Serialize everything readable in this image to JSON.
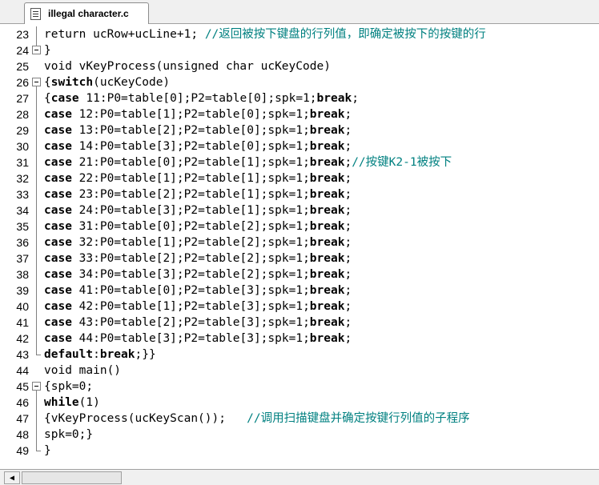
{
  "tab": {
    "label": "illegal character.c",
    "icon": "document-icon"
  },
  "editor": {
    "lines": [
      {
        "n": "23",
        "fold": "line",
        "segs": [
          [
            "t",
            "return ucRow+ucLine+"
          ],
          [
            "n",
            "1"
          ],
          [
            "t",
            "; "
          ],
          [
            "c",
            "//返回被按下键盘的行列值，即确定被按下的按键的行"
          ]
        ]
      },
      {
        "n": "24",
        "fold": "box",
        "segs": [
          [
            "t",
            "}"
          ]
        ]
      },
      {
        "n": "25",
        "fold": "none",
        "segs": [
          [
            "t",
            "void vKeyProcess(unsigned char ucKeyCode)"
          ]
        ]
      },
      {
        "n": "26",
        "fold": "box",
        "segs": [
          [
            "t",
            "{"
          ],
          [
            "k",
            "switch"
          ],
          [
            "t",
            "(ucKeyCode)"
          ]
        ]
      },
      {
        "n": "27",
        "fold": "line",
        "segs": [
          [
            "t",
            "{"
          ],
          [
            "k",
            "case"
          ],
          [
            "t",
            " "
          ],
          [
            "n",
            "11"
          ],
          [
            "t",
            ":P0=table["
          ],
          [
            "n",
            "0"
          ],
          [
            "t",
            "];P2=table["
          ],
          [
            "n",
            "0"
          ],
          [
            "t",
            "];spk="
          ],
          [
            "n",
            "1"
          ],
          [
            "t",
            ";"
          ],
          [
            "k",
            "break"
          ],
          [
            "t",
            ";"
          ]
        ]
      },
      {
        "n": "28",
        "fold": "line",
        "segs": [
          [
            "k",
            "case"
          ],
          [
            "t",
            " "
          ],
          [
            "n",
            "12"
          ],
          [
            "t",
            ":P0=table["
          ],
          [
            "n",
            "1"
          ],
          [
            "t",
            "];P2=table["
          ],
          [
            "n",
            "0"
          ],
          [
            "t",
            "];spk="
          ],
          [
            "n",
            "1"
          ],
          [
            "t",
            ";"
          ],
          [
            "k",
            "break"
          ],
          [
            "t",
            ";"
          ]
        ]
      },
      {
        "n": "29",
        "fold": "line",
        "segs": [
          [
            "k",
            "case"
          ],
          [
            "t",
            " "
          ],
          [
            "n",
            "13"
          ],
          [
            "t",
            ":P0=table["
          ],
          [
            "n",
            "2"
          ],
          [
            "t",
            "];P2=table["
          ],
          [
            "n",
            "0"
          ],
          [
            "t",
            "];spk="
          ],
          [
            "n",
            "1"
          ],
          [
            "t",
            ";"
          ],
          [
            "k",
            "break"
          ],
          [
            "t",
            ";"
          ]
        ]
      },
      {
        "n": "30",
        "fold": "line",
        "segs": [
          [
            "k",
            "case"
          ],
          [
            "t",
            " "
          ],
          [
            "n",
            "14"
          ],
          [
            "t",
            ":P0=table["
          ],
          [
            "n",
            "3"
          ],
          [
            "t",
            "];P2=table["
          ],
          [
            "n",
            "0"
          ],
          [
            "t",
            "];spk="
          ],
          [
            "n",
            "1"
          ],
          [
            "t",
            ";"
          ],
          [
            "k",
            "break"
          ],
          [
            "t",
            ";"
          ]
        ]
      },
      {
        "n": "31",
        "fold": "line",
        "segs": [
          [
            "k",
            "case"
          ],
          [
            "t",
            " "
          ],
          [
            "n",
            "21"
          ],
          [
            "t",
            ":P0=table["
          ],
          [
            "n",
            "0"
          ],
          [
            "t",
            "];P2=table["
          ],
          [
            "n",
            "1"
          ],
          [
            "t",
            "];spk="
          ],
          [
            "n",
            "1"
          ],
          [
            "t",
            ";"
          ],
          [
            "k",
            "break"
          ],
          [
            "t",
            ";"
          ],
          [
            "c",
            "//按键K2-1被按下"
          ]
        ]
      },
      {
        "n": "32",
        "fold": "line",
        "segs": [
          [
            "k",
            "case"
          ],
          [
            "t",
            " "
          ],
          [
            "n",
            "22"
          ],
          [
            "t",
            ":P0=table["
          ],
          [
            "n",
            "1"
          ],
          [
            "t",
            "];P2=table["
          ],
          [
            "n",
            "1"
          ],
          [
            "t",
            "];spk="
          ],
          [
            "n",
            "1"
          ],
          [
            "t",
            ";"
          ],
          [
            "k",
            "break"
          ],
          [
            "t",
            ";"
          ]
        ]
      },
      {
        "n": "33",
        "fold": "line",
        "segs": [
          [
            "k",
            "case"
          ],
          [
            "t",
            " "
          ],
          [
            "n",
            "23"
          ],
          [
            "t",
            ":P0=table["
          ],
          [
            "n",
            "2"
          ],
          [
            "t",
            "];P2=table["
          ],
          [
            "n",
            "1"
          ],
          [
            "t",
            "];spk="
          ],
          [
            "n",
            "1"
          ],
          [
            "t",
            ";"
          ],
          [
            "k",
            "break"
          ],
          [
            "t",
            ";"
          ]
        ]
      },
      {
        "n": "34",
        "fold": "line",
        "segs": [
          [
            "k",
            "case"
          ],
          [
            "t",
            " "
          ],
          [
            "n",
            "24"
          ],
          [
            "t",
            ":P0=table["
          ],
          [
            "n",
            "3"
          ],
          [
            "t",
            "];P2=table["
          ],
          [
            "n",
            "1"
          ],
          [
            "t",
            "];spk="
          ],
          [
            "n",
            "1"
          ],
          [
            "t",
            ";"
          ],
          [
            "k",
            "break"
          ],
          [
            "t",
            ";"
          ]
        ]
      },
      {
        "n": "35",
        "fold": "line",
        "segs": [
          [
            "k",
            "case"
          ],
          [
            "t",
            " "
          ],
          [
            "n",
            "31"
          ],
          [
            "t",
            ":P0=table["
          ],
          [
            "n",
            "0"
          ],
          [
            "t",
            "];P2=table["
          ],
          [
            "n",
            "2"
          ],
          [
            "t",
            "];spk="
          ],
          [
            "n",
            "1"
          ],
          [
            "t",
            ";"
          ],
          [
            "k",
            "break"
          ],
          [
            "t",
            ";"
          ]
        ]
      },
      {
        "n": "36",
        "fold": "line",
        "segs": [
          [
            "k",
            "case"
          ],
          [
            "t",
            " "
          ],
          [
            "n",
            "32"
          ],
          [
            "t",
            ":P0=table["
          ],
          [
            "n",
            "1"
          ],
          [
            "t",
            "];P2=table["
          ],
          [
            "n",
            "2"
          ],
          [
            "t",
            "];spk="
          ],
          [
            "n",
            "1"
          ],
          [
            "t",
            ";"
          ],
          [
            "k",
            "break"
          ],
          [
            "t",
            ";"
          ]
        ]
      },
      {
        "n": "37",
        "fold": "line",
        "segs": [
          [
            "k",
            "case"
          ],
          [
            "t",
            " "
          ],
          [
            "n",
            "33"
          ],
          [
            "t",
            ":P0=table["
          ],
          [
            "n",
            "2"
          ],
          [
            "t",
            "];P2=table["
          ],
          [
            "n",
            "2"
          ],
          [
            "t",
            "];spk="
          ],
          [
            "n",
            "1"
          ],
          [
            "t",
            ";"
          ],
          [
            "k",
            "break"
          ],
          [
            "t",
            ";"
          ]
        ]
      },
      {
        "n": "38",
        "fold": "line",
        "segs": [
          [
            "k",
            "case"
          ],
          [
            "t",
            " "
          ],
          [
            "n",
            "34"
          ],
          [
            "t",
            ":P0=table["
          ],
          [
            "n",
            "3"
          ],
          [
            "t",
            "];P2=table["
          ],
          [
            "n",
            "2"
          ],
          [
            "t",
            "];spk="
          ],
          [
            "n",
            "1"
          ],
          [
            "t",
            ";"
          ],
          [
            "k",
            "break"
          ],
          [
            "t",
            ";"
          ]
        ]
      },
      {
        "n": "39",
        "fold": "line",
        "segs": [
          [
            "k",
            "case"
          ],
          [
            "t",
            " "
          ],
          [
            "n",
            "41"
          ],
          [
            "t",
            ":P0=table["
          ],
          [
            "n",
            "0"
          ],
          [
            "t",
            "];P2=table["
          ],
          [
            "n",
            "3"
          ],
          [
            "t",
            "];spk="
          ],
          [
            "n",
            "1"
          ],
          [
            "t",
            ";"
          ],
          [
            "k",
            "break"
          ],
          [
            "t",
            ";"
          ]
        ]
      },
      {
        "n": "40",
        "fold": "line",
        "segs": [
          [
            "k",
            "case"
          ],
          [
            "t",
            " "
          ],
          [
            "n",
            "42"
          ],
          [
            "t",
            ":P0=table["
          ],
          [
            "n",
            "1"
          ],
          [
            "t",
            "];P2=table["
          ],
          [
            "n",
            "3"
          ],
          [
            "t",
            "];spk="
          ],
          [
            "n",
            "1"
          ],
          [
            "t",
            ";"
          ],
          [
            "k",
            "break"
          ],
          [
            "t",
            ";"
          ]
        ]
      },
      {
        "n": "41",
        "fold": "line",
        "segs": [
          [
            "k",
            "case"
          ],
          [
            "t",
            " "
          ],
          [
            "n",
            "43"
          ],
          [
            "t",
            ":P0=table["
          ],
          [
            "n",
            "2"
          ],
          [
            "t",
            "];P2=table["
          ],
          [
            "n",
            "3"
          ],
          [
            "t",
            "];spk="
          ],
          [
            "n",
            "1"
          ],
          [
            "t",
            ";"
          ],
          [
            "k",
            "break"
          ],
          [
            "t",
            ";"
          ]
        ]
      },
      {
        "n": "42",
        "fold": "line",
        "segs": [
          [
            "k",
            "case"
          ],
          [
            "t",
            " "
          ],
          [
            "n",
            "44"
          ],
          [
            "t",
            ":P0=table["
          ],
          [
            "n",
            "3"
          ],
          [
            "t",
            "];P2=table["
          ],
          [
            "n",
            "3"
          ],
          [
            "t",
            "];spk="
          ],
          [
            "n",
            "1"
          ],
          [
            "t",
            ";"
          ],
          [
            "k",
            "break"
          ],
          [
            "t",
            ";"
          ]
        ]
      },
      {
        "n": "43",
        "fold": "end",
        "segs": [
          [
            "k",
            "default"
          ],
          [
            "t",
            ":"
          ],
          [
            "k",
            "break"
          ],
          [
            "t",
            ";}}"
          ]
        ]
      },
      {
        "n": "44",
        "fold": "none",
        "segs": [
          [
            "t",
            "void main()"
          ]
        ]
      },
      {
        "n": "45",
        "fold": "box",
        "segs": [
          [
            "t",
            "{spk="
          ],
          [
            "n",
            "0"
          ],
          [
            "t",
            ";"
          ]
        ]
      },
      {
        "n": "46",
        "fold": "line",
        "segs": [
          [
            "k",
            "while"
          ],
          [
            "t",
            "("
          ],
          [
            "n",
            "1"
          ],
          [
            "t",
            ")"
          ]
        ]
      },
      {
        "n": "47",
        "fold": "line",
        "segs": [
          [
            "t",
            "{vKeyProcess(ucKeyScan());   "
          ],
          [
            "c",
            "//调用扫描键盘并确定按键行列值的子程序"
          ]
        ]
      },
      {
        "n": "48",
        "fold": "line",
        "segs": [
          [
            "t",
            "spk="
          ],
          [
            "n",
            "0"
          ],
          [
            "t",
            ";}"
          ]
        ]
      },
      {
        "n": "49",
        "fold": "end",
        "segs": [
          [
            "t",
            "}"
          ]
        ]
      }
    ]
  },
  "scrollbar": {
    "left_arrow": "◀",
    "thumb": "scroll-thumb"
  }
}
